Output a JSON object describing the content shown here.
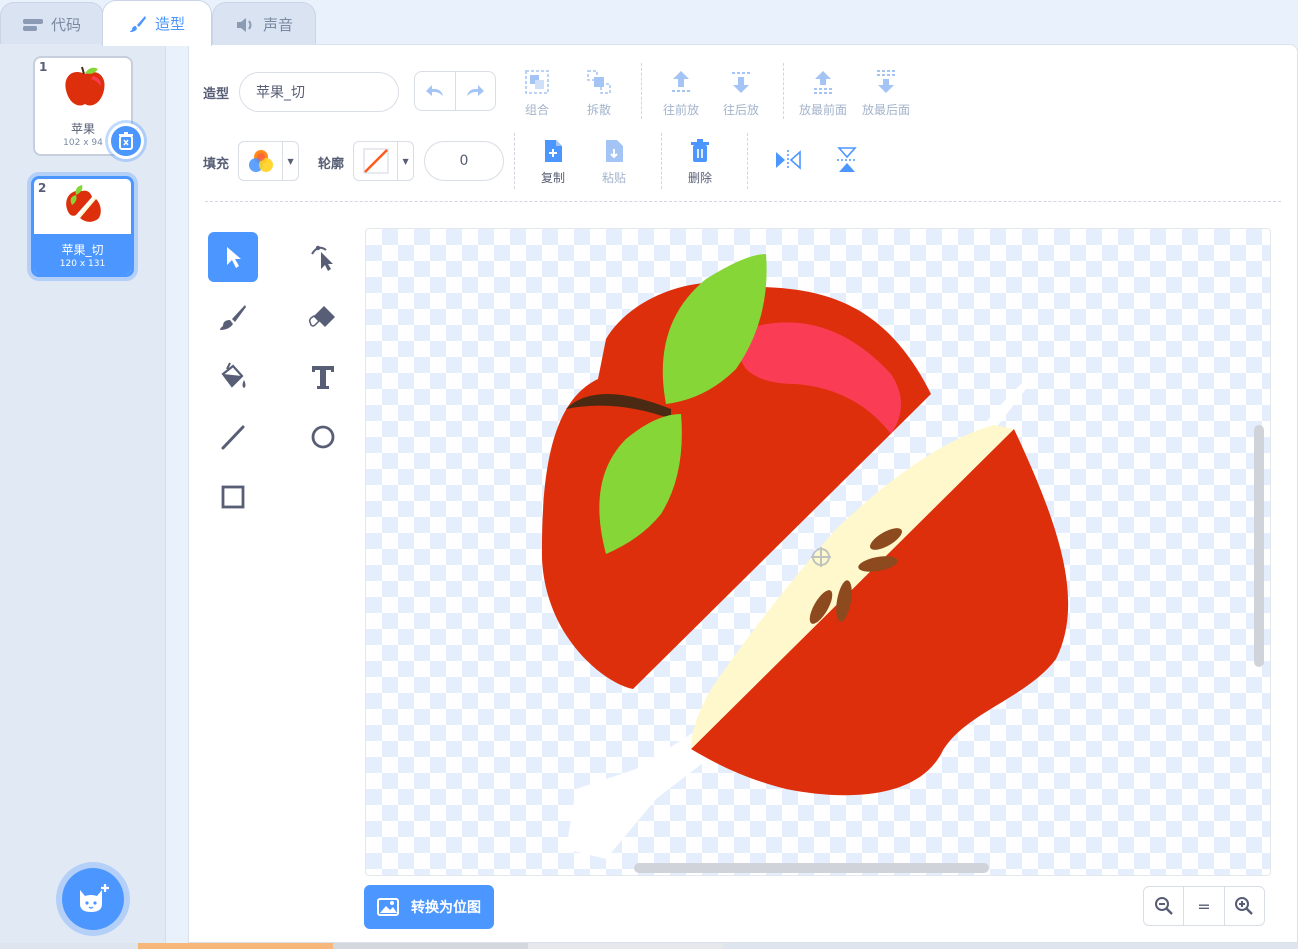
{
  "tabs": {
    "code": "代码",
    "costumes": "造型",
    "sounds": "声音"
  },
  "costumes": [
    {
      "num": "1",
      "name": "苹果",
      "size": "102 x 94"
    },
    {
      "num": "2",
      "name": "苹果_切",
      "size": "120 x 131"
    }
  ],
  "toolbar": {
    "costume_label": "造型",
    "costume_name": "苹果_切",
    "group": "组合",
    "ungroup": "拆散",
    "forward": "往前放",
    "backward": "往后放",
    "front": "放最前面",
    "back": "放最后面",
    "fill_label": "填充",
    "outline_label": "轮廓",
    "outline_width": "0",
    "copy": "复制",
    "paste": "粘贴",
    "delete": "删除"
  },
  "bottom": {
    "convert_bitmap": "转换为位图",
    "zoom_reset": "="
  },
  "colors": {
    "accent": "#4c97ff",
    "apple_red": "#de2f0c",
    "leaf_green": "#85d636",
    "apple_flesh": "#fff8cc",
    "seed_brown": "#8c4a1e",
    "highlight_pink": "#fa3d55"
  }
}
